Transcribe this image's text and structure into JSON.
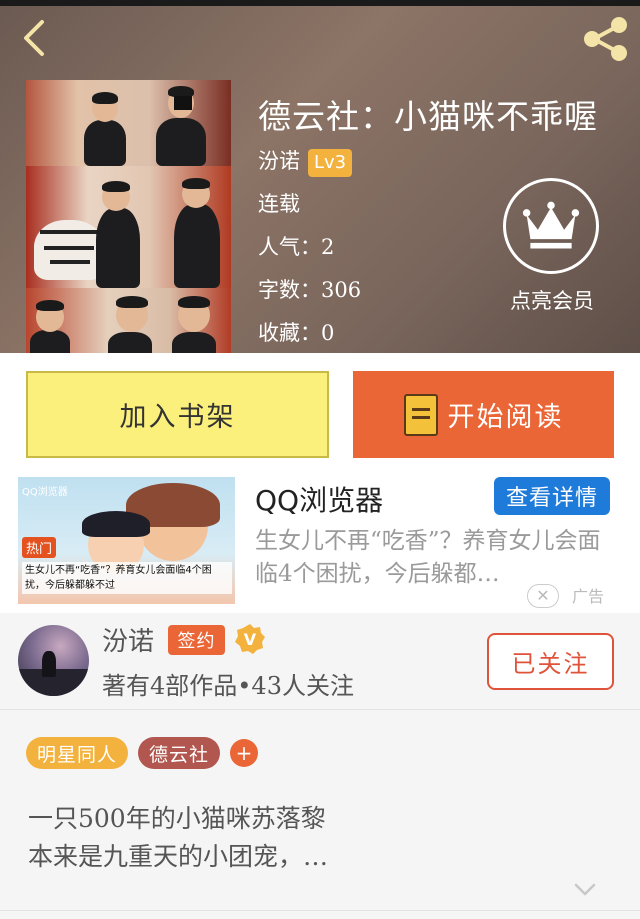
{
  "header": {
    "back_icon": "chevron-left-icon",
    "share_icon": "share-icon"
  },
  "book": {
    "title": "德云社：小猫咪不乖喔",
    "author": "汾诺",
    "author_level": "Lv3",
    "status": "连载",
    "popularity": "人气：2",
    "word_count": "字数：306",
    "favorites": "收藏：0",
    "vip_label": "点亮会员"
  },
  "actions": {
    "add_shelf": "加入书架",
    "start_read": "开始阅读"
  },
  "ad": {
    "image_brand": "QQ浏览器",
    "image_hot": "热门",
    "image_caption": "生女儿不再“吃香”？养育女儿会面临4个困扰，今后躲都躲不过",
    "title": "QQ浏览器",
    "detail_button": "查看详情",
    "description": "生女儿不再“吃香”？养育女儿会面临4个困扰，今后躲都…",
    "close": "✕",
    "ad_tag": "广告"
  },
  "author_card": {
    "name": "汾诺",
    "signed_badge": "签约",
    "v_badge": "V",
    "stats": "著有4部作品•43人关注",
    "follow_button": "已关注"
  },
  "tags": [
    {
      "label": "明星同人",
      "color": "#f3b23d"
    },
    {
      "label": "德云社",
      "color": "#b1574f"
    }
  ],
  "tag_add": "+",
  "synopsis": {
    "line1": "一只500年的小猫咪苏落黎",
    "line2": "本来是九重天的小团宠，…"
  },
  "colors": {
    "accent_orange": "#ea6636",
    "shelf_yellow": "#fbf07c",
    "ad_blue": "#1f7bd9",
    "level_gold": "#f3b23d"
  }
}
